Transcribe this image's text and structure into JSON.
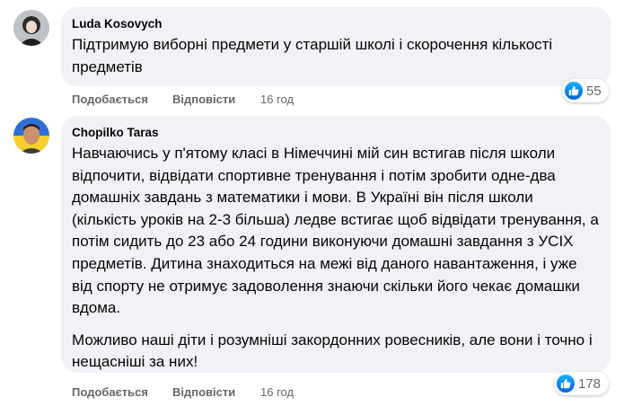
{
  "comments": [
    {
      "author": "Luda Kosovych",
      "text": "Підтримую виборні предмети у старшій школі і скорочення кількості предметів",
      "actions": {
        "like": "Подобається",
        "reply": "Відповісти",
        "time": "16 год"
      },
      "reactions": {
        "icon": "like-icon",
        "count": "55"
      }
    },
    {
      "author": "Chopilko Taras",
      "paragraph1": "Навчаючись у п'ятому класі в Німеччині мій син встигав після школи відпочити, відвідати спортивне тренування і потім зробити одне-два домашніх завдань з математики і мови. В Україні він після школи (кількість уроків на 2-3 більша) ледве встигає щоб відвідати тренування, а потім сидить до 23 або 24 години виконуючи домашні завдання з УСІХ предметів. Дитина знаходиться на межі від даного навантаження, і уже від спорту не отримує задоволення знаючи скільки його чекає домашки вдома.",
      "paragraph2": "Можливо наші діти і розумніші закордонних ровесників, але вони і точно і нещасніші за них!",
      "actions": {
        "like": "Подобається",
        "reply": "Відповісти",
        "time": "16 год"
      },
      "reactions": {
        "icon": "like-icon",
        "count": "178"
      }
    }
  ],
  "colors": {
    "bubble": "#f0f2f5",
    "meta": "#65676b",
    "like": "#0866ff"
  }
}
